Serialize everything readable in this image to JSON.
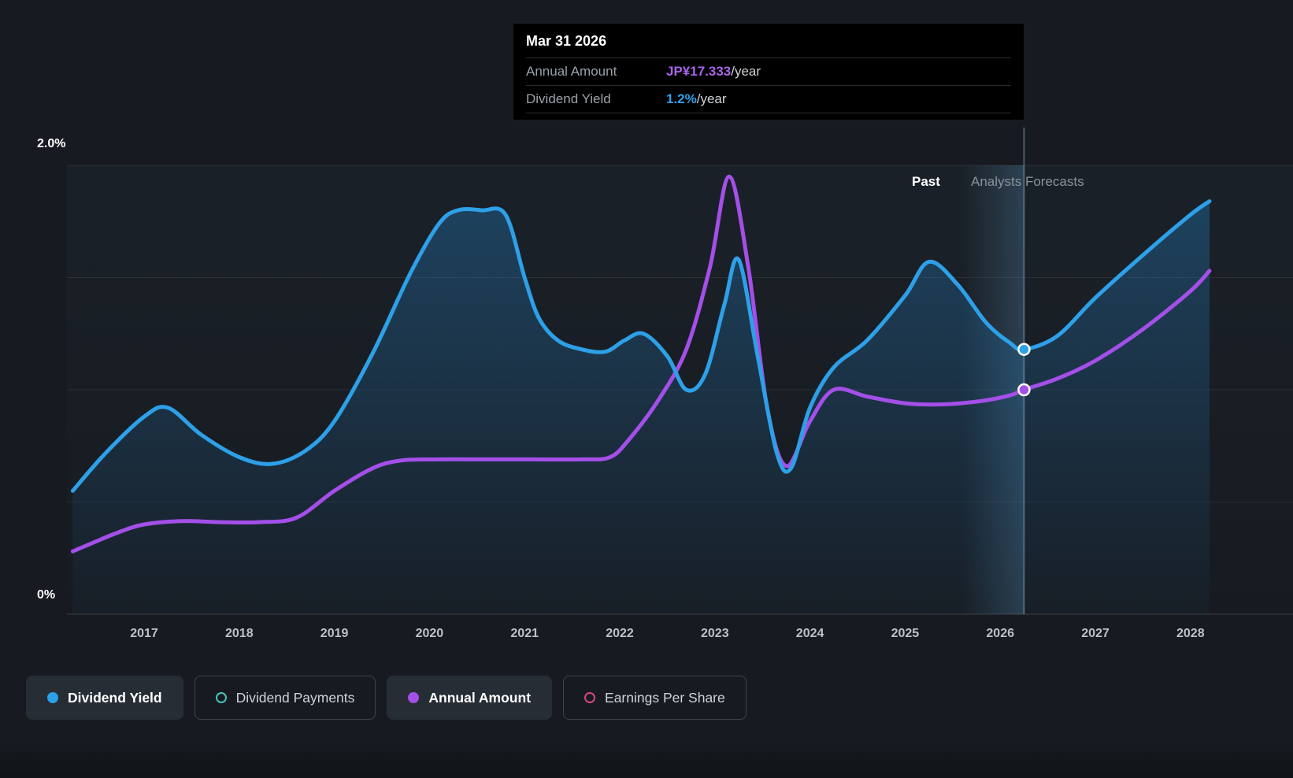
{
  "colors": {
    "background": "#171b21",
    "tooltip_background": "#000000",
    "dividend_yield": "#2da0e8",
    "annual_amount": "#a44fe8",
    "dividend_payments": "#47c4b8",
    "earnings_per_share": "#d8487e"
  },
  "tooltip": {
    "date": "Mar 31 2026",
    "rows": [
      {
        "label": "Annual Amount",
        "value": "JP¥17.333",
        "suffix": "/year"
      },
      {
        "label": "Dividend Yield",
        "value": "1.2%",
        "suffix": "/year"
      }
    ]
  },
  "annotations": {
    "past": "Past",
    "forecast": "Analysts Forecasts"
  },
  "y_axis": {
    "top": "2.0%",
    "bottom": "0%"
  },
  "x_axis": {
    "labels": [
      "2017",
      "2018",
      "2019",
      "2020",
      "2021",
      "2022",
      "2023",
      "2024",
      "2025",
      "2026",
      "2027",
      "2028"
    ]
  },
  "legend": {
    "items": [
      {
        "label": "Dividend Yield",
        "marker": "filled",
        "color": "#2da0e8",
        "active": true
      },
      {
        "label": "Dividend Payments",
        "marker": "outline",
        "color": "#47c4b8",
        "active": false
      },
      {
        "label": "Annual Amount",
        "marker": "filled",
        "color": "#a44fe8",
        "active": true
      },
      {
        "label": "Earnings Per Share",
        "marker": "outline",
        "color": "#d8487e",
        "active": false
      }
    ]
  },
  "chart_data": {
    "type": "line",
    "title": "Dividend yield history and analysts forecasts",
    "ylabel": "Dividend Yield",
    "ylim": [
      0,
      2.0
    ],
    "xlim": [
      2016.25,
      2028.25
    ],
    "y_ticks": [
      "0%",
      "2.0%"
    ],
    "x_ticks": [
      2017,
      2018,
      2019,
      2020,
      2021,
      2022,
      2023,
      2024,
      2025,
      2026,
      2027,
      2028
    ],
    "grid": true,
    "legend_position": "bottom",
    "divider_x": 2026.25,
    "forecast_band_start_x": 2025.6,
    "series": [
      {
        "name": "Dividend Yield",
        "unit": "%",
        "color": "#2da0e8",
        "area": true,
        "points": [
          [
            2016.25,
            0.55
          ],
          [
            2016.6,
            0.72
          ],
          [
            2017.0,
            0.88
          ],
          [
            2017.25,
            0.92
          ],
          [
            2017.6,
            0.8
          ],
          [
            2018.0,
            0.7
          ],
          [
            2018.35,
            0.67
          ],
          [
            2018.7,
            0.73
          ],
          [
            2019.0,
            0.86
          ],
          [
            2019.4,
            1.16
          ],
          [
            2019.8,
            1.52
          ],
          [
            2020.1,
            1.74
          ],
          [
            2020.3,
            1.8
          ],
          [
            2020.55,
            1.8
          ],
          [
            2020.8,
            1.78
          ],
          [
            2021.0,
            1.5
          ],
          [
            2021.15,
            1.32
          ],
          [
            2021.35,
            1.22
          ],
          [
            2021.6,
            1.18
          ],
          [
            2021.85,
            1.17
          ],
          [
            2022.05,
            1.22
          ],
          [
            2022.25,
            1.25
          ],
          [
            2022.5,
            1.15
          ],
          [
            2022.7,
            1.0
          ],
          [
            2022.9,
            1.07
          ],
          [
            2023.1,
            1.38
          ],
          [
            2023.25,
            1.58
          ],
          [
            2023.45,
            1.15
          ],
          [
            2023.65,
            0.72
          ],
          [
            2023.8,
            0.65
          ],
          [
            2024.0,
            0.92
          ],
          [
            2024.25,
            1.1
          ],
          [
            2024.6,
            1.22
          ],
          [
            2025.0,
            1.42
          ],
          [
            2025.25,
            1.57
          ],
          [
            2025.55,
            1.47
          ],
          [
            2025.85,
            1.3
          ],
          [
            2026.1,
            1.21
          ],
          [
            2026.25,
            1.18
          ],
          [
            2026.6,
            1.24
          ],
          [
            2027.0,
            1.41
          ],
          [
            2027.5,
            1.6
          ],
          [
            2028.0,
            1.78
          ],
          [
            2028.2,
            1.84
          ]
        ]
      },
      {
        "name": "Annual Amount",
        "unit": "yield-scale (1.0 corresponds to JP¥17.333/year)",
        "color": "#a44fe8",
        "area": false,
        "points": [
          [
            2016.25,
            0.28
          ],
          [
            2016.7,
            0.36
          ],
          [
            2017.0,
            0.4
          ],
          [
            2017.4,
            0.415
          ],
          [
            2017.8,
            0.41
          ],
          [
            2018.2,
            0.41
          ],
          [
            2018.6,
            0.43
          ],
          [
            2019.0,
            0.55
          ],
          [
            2019.4,
            0.65
          ],
          [
            2019.7,
            0.685
          ],
          [
            2020.1,
            0.69
          ],
          [
            2020.6,
            0.69
          ],
          [
            2021.1,
            0.69
          ],
          [
            2021.6,
            0.69
          ],
          [
            2021.9,
            0.7
          ],
          [
            2022.1,
            0.78
          ],
          [
            2022.4,
            0.95
          ],
          [
            2022.7,
            1.18
          ],
          [
            2022.95,
            1.55
          ],
          [
            2023.15,
            1.95
          ],
          [
            2023.35,
            1.55
          ],
          [
            2023.55,
            0.92
          ],
          [
            2023.75,
            0.66
          ],
          [
            2024.0,
            0.86
          ],
          [
            2024.25,
            1.0
          ],
          [
            2024.6,
            0.97
          ],
          [
            2025.0,
            0.94
          ],
          [
            2025.4,
            0.935
          ],
          [
            2025.8,
            0.95
          ],
          [
            2026.1,
            0.975
          ],
          [
            2026.25,
            1.0
          ],
          [
            2026.6,
            1.05
          ],
          [
            2027.0,
            1.13
          ],
          [
            2027.5,
            1.27
          ],
          [
            2028.0,
            1.44
          ],
          [
            2028.2,
            1.53
          ]
        ]
      }
    ],
    "markers": [
      {
        "series": "Dividend Yield",
        "x": 2026.25,
        "y": 1.18,
        "label": "1.2%/year"
      },
      {
        "series": "Annual Amount",
        "x": 2026.25,
        "y": 1.0,
        "label": "JP¥17.333/year"
      }
    ]
  }
}
